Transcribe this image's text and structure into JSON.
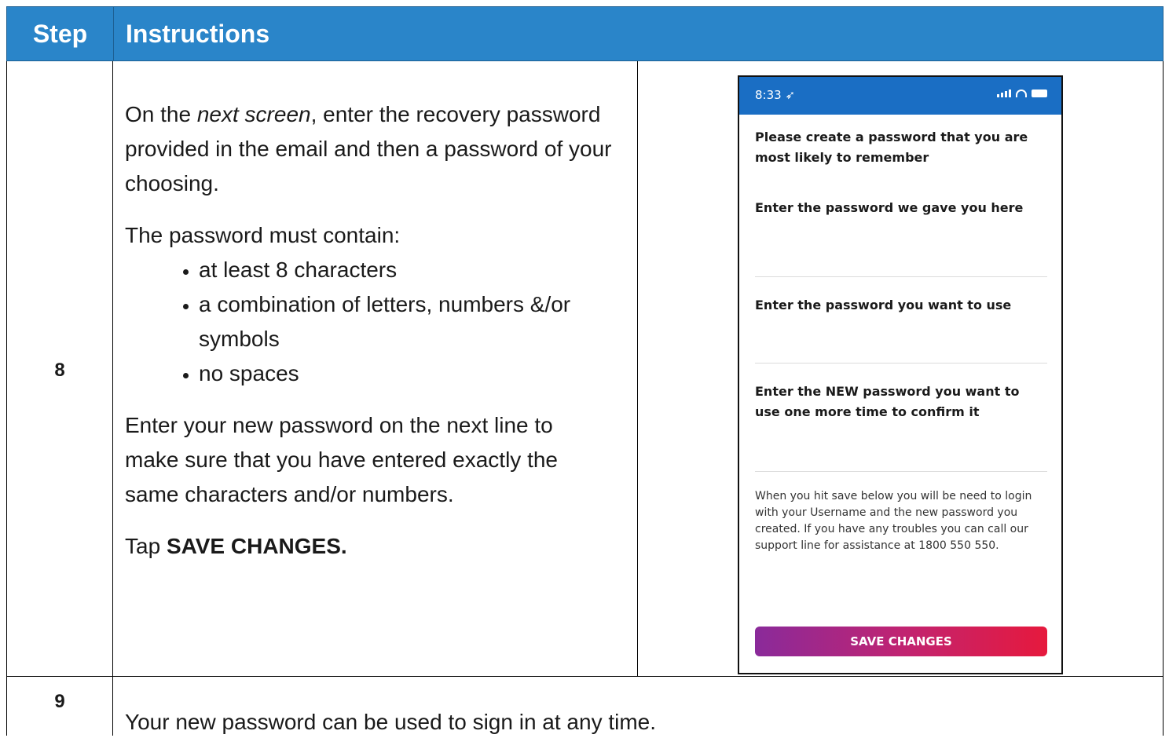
{
  "header": {
    "step": "Step",
    "instructions": "Instructions"
  },
  "row8": {
    "step": "8",
    "para1_a": "On the ",
    "para1_em": "next screen",
    "para1_b": ", enter the recovery password provided in the email and then a password of your choosing.",
    "para2": "The password must contain:",
    "bullets": [
      "at least 8 characters",
      "a combination of letters, numbers &/or symbols",
      "no spaces"
    ],
    "para3": "Enter your new password on the next line to make sure that you have entered exactly the same characters and/or numbers.",
    "tap_prefix": "Tap ",
    "tap_bold": "SAVE CHANGES."
  },
  "phone": {
    "time": "8:33 ➶",
    "heading": "Please create a password that you are most likely to remember",
    "field1_label": "Enter the password we gave you here",
    "field2_label": "Enter the password you want to use",
    "field3_label": "Enter the NEW password you want to use one more time to confirm it",
    "note": "When you hit save below you will be need to login with your Username and the new password you created. If you have any troubles you can call our support line for assistance at 1800 550 550.",
    "save_label": "SAVE CHANGES",
    "colors": {
      "status_bar": "#1a6ec4",
      "button_start": "#8a2a9a",
      "button_end": "#e6193d"
    }
  },
  "row9": {
    "step": "9",
    "text": "Your new password can be used to sign in at any time."
  },
  "colors": {
    "header_bg": "#2a85c9"
  }
}
